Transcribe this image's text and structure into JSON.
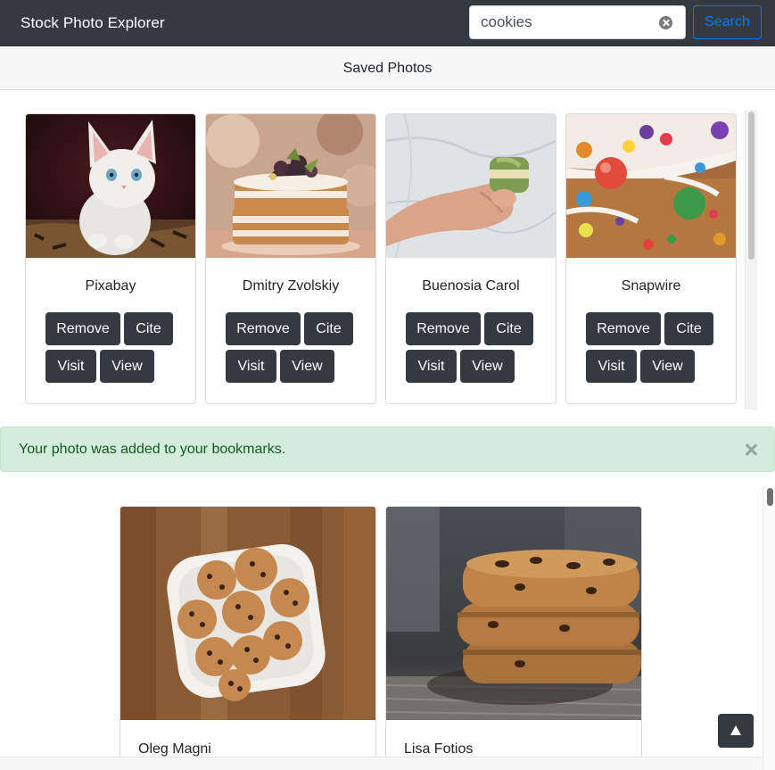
{
  "app": {
    "title": "Stock Photo Explorer"
  },
  "search": {
    "value": "cookies",
    "button_label": "Search"
  },
  "saved": {
    "heading": "Saved Photos",
    "cards": [
      {
        "author": "Pixabay",
        "image": "white-kitten-photo"
      },
      {
        "author": "Dmitry Zvolskiy",
        "image": "layer-cake-photo"
      },
      {
        "author": "Buenosia Carol",
        "image": "hand-holding-macaron-photo"
      },
      {
        "author": "Snapwire",
        "image": "gingerbread-candy-photo"
      }
    ],
    "buttons": {
      "remove": "Remove",
      "cite": "Cite",
      "visit": "Visit",
      "view": "View"
    }
  },
  "alert": {
    "message": "Your photo was added to your bookmarks.",
    "close_icon": "close-icon"
  },
  "results": {
    "cards": [
      {
        "author": "Oleg Magni",
        "image": "cookies-plate-photo"
      },
      {
        "author": "Lisa Fotios",
        "image": "cookie-stack-photo"
      }
    ]
  },
  "back_to_top_icon": "arrow-up-icon",
  "colors": {
    "navbar": "#343a40",
    "primary": "#007bff",
    "button_dark": "#343a40",
    "alert_bg": "#d4edda",
    "alert_text": "#155724"
  }
}
